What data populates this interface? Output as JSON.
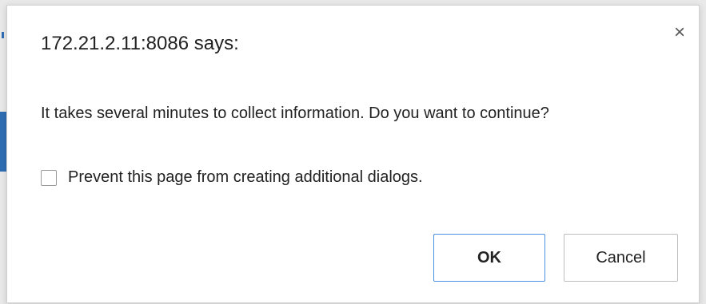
{
  "dialog": {
    "title": "172.21.2.11:8086 says:",
    "close_glyph": "×",
    "message": "It takes several minutes to collect information. Do you want to continue?",
    "prevent_label": "Prevent this page from creating additional dialogs.",
    "prevent_checked": false,
    "ok_label": "OK",
    "cancel_label": "Cancel"
  },
  "colors": {
    "ok_border": "#4a90e2",
    "backdrop_accent": "#2f6db3"
  },
  "icons": {
    "close": "close-icon",
    "checkbox": "checkbox-icon"
  }
}
